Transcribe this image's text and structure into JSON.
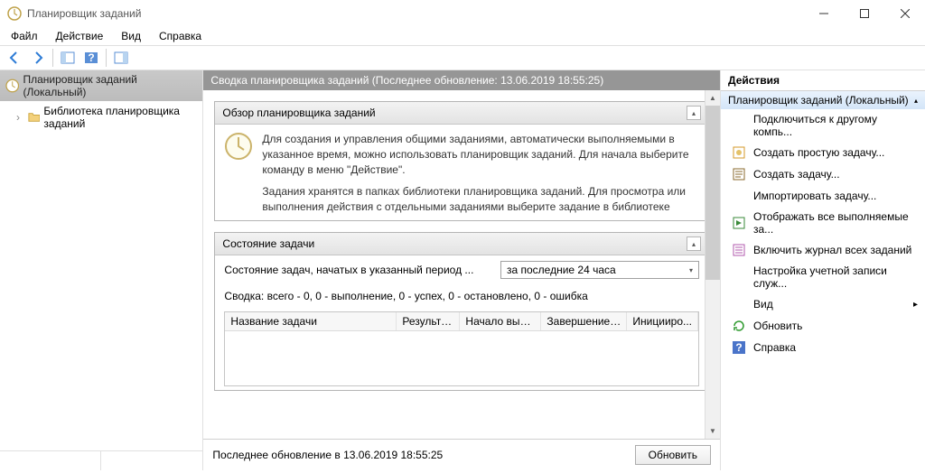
{
  "window": {
    "title": "Планировщик заданий"
  },
  "menu": {
    "file": "Файл",
    "action": "Действие",
    "view": "Вид",
    "help": "Справка"
  },
  "tree": {
    "root": "Планировщик заданий (Локальный)",
    "lib": "Библиотека планировщика заданий"
  },
  "center": {
    "header_prefix": "Сводка планировщика заданий (Последнее обновление: ",
    "header_time": "13.06.2019 18:55:25",
    "header_suffix": ")",
    "overview_title": "Обзор планировщика заданий",
    "overview_p1": "Для создания и управления общими заданиями, автоматически выполняемыми в указанное время, можно использовать планировщик заданий. Для начала выберите команду в меню \"Действие\".",
    "overview_p2": "Задания хранятся в папках библиотеки планировщика заданий. Для просмотра или выполнения действия с отдельными заданиями выберите задание в библиотеке планировщика заданий и щелкните команду в меню \"Действие\".",
    "status_title": "Состояние задачи",
    "status_label": "Состояние задач, начатых в указанный период ...",
    "status_dropdown": "за последние 24 часа",
    "status_summary": "Сводка: всего - 0, 0 - выполнение, 0 - успех, 0 - остановлено, 0 - ошибка",
    "cols": {
      "name": "Название задачи",
      "result": "Результат...",
      "start": "Начало выпо...",
      "end": "Завершение в...",
      "init": "Иницииро..."
    },
    "footer_prefix": "Последнее обновление в ",
    "footer_time": "13.06.2019 18:55:25",
    "refresh_btn": "Обновить"
  },
  "actions": {
    "title": "Действия",
    "group": "Планировщик заданий (Локальный)",
    "items": [
      "Подключиться к другому компь...",
      "Создать простую задачу...",
      "Создать задачу...",
      "Импортировать задачу...",
      "Отображать все выполняемые за...",
      "Включить журнал всех заданий",
      "Настройка учетной записи служ...",
      "Вид",
      "Обновить",
      "Справка"
    ]
  }
}
